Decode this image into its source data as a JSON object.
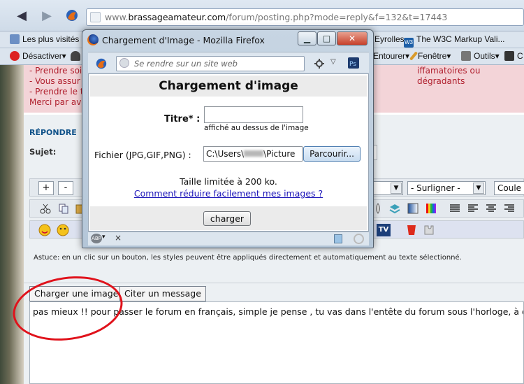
{
  "browser": {
    "url_prefix": "www.",
    "url_host": "brassageamateur.com",
    "url_path": "/forum/posting.php?mode=reply&f=132&t=17443"
  },
  "bookmarks": {
    "items": [
      "Les plus visités",
      "Eyrolles",
      "The W3C Markup Vali..."
    ]
  },
  "toolbar": {
    "desactiver": "Désactiver▾",
    "entourer": "Entourer▾",
    "fenetre": "Fenêtre▾",
    "outils": "Outils▾",
    "tail": "C"
  },
  "warning": {
    "line1": "- Prendre soi",
    "line1_tail": "iffamatoires ou dégradants",
    "line2": "- Vous assur",
    "line3": "- Prendre le t",
    "line4": "Merci par ava"
  },
  "reply": {
    "title": "RÉPONDRE",
    "subject_label": "Sujet:"
  },
  "editor_toolbar": {
    "plus": "+",
    "minus": "-",
    "highlight_select": "- Surligner -",
    "color_tail": "Coule"
  },
  "astuce": "Astuce: en un clic sur un bouton, les styles peuvent être appliqués directement et automatiquement au texte sélectionné.",
  "editor_buttons": {
    "upload_image": "Charger une image",
    "quote": "Citer un message"
  },
  "message_text": "pas mieux !! pour passer le forum en français, simple je pense , tu vas dans l'entête du forum sous l'horloge, à droite, t",
  "popup": {
    "window_title": "Chargement d'Image - Mozilla Firefox",
    "url_placeholder": "Se rendre sur un site web",
    "heading": "Chargement d'image",
    "title_label": "Titre* :",
    "title_hint": "affiché au dessus de l'image",
    "file_label": "Fichier (JPG,GIF,PNG) :",
    "file_value_start": "C:\\Users\\",
    "file_value_end": "\\Picture",
    "browse_label": "Parcourir...",
    "size_limit": "Taille limitée à 200 ko.",
    "howto_link": "Comment réduire facilement mes images ?",
    "submit_label": "charger",
    "status_close": "×"
  },
  "colors": {
    "accent_link": "#1a13b8",
    "warning_text": "#b0202e",
    "warning_bg": "#f3d4d8",
    "annotation": "#e0121b"
  }
}
